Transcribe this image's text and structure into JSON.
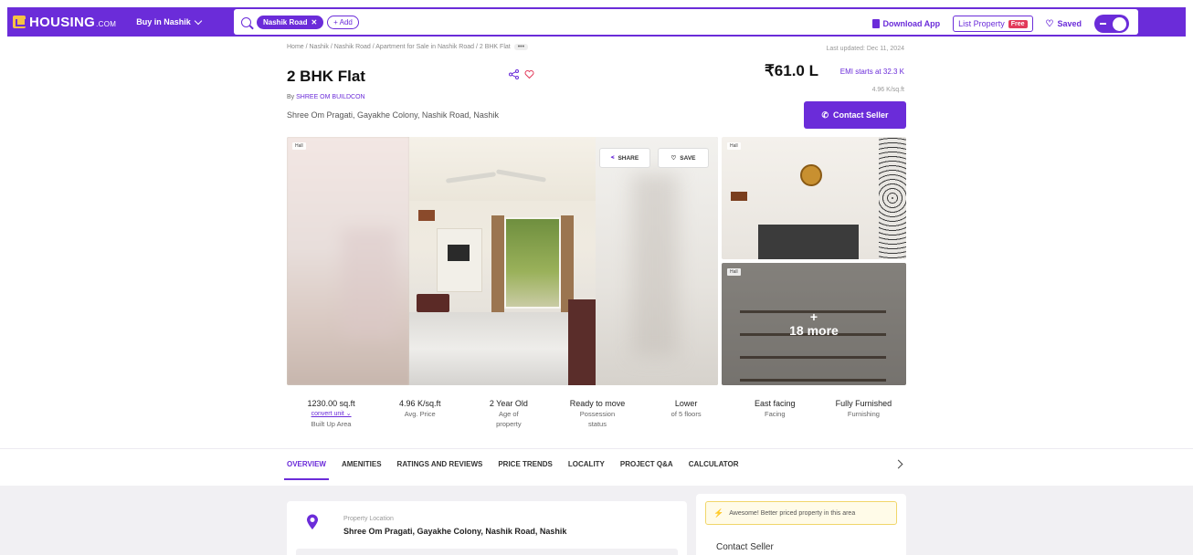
{
  "nav": {
    "logo_text": "HOUSING",
    "logo_suffix": ".COM",
    "buy_in": "Buy in Nashik",
    "search_chip": "Nashik Road",
    "add_label": "+ Add",
    "download_app": "Download App",
    "list_property": "List Property",
    "free_badge": "Free",
    "saved": "Saved"
  },
  "header": {
    "breadcrumb": "Home / Nashik / Nashik Road / Apartment for Sale in Nashik Road / 2 BHK Flat",
    "breadcrumb_more": "•••",
    "last_updated": "Last updated: Dec 11, 2024",
    "title": "2 BHK Flat",
    "by_prefix": "By ",
    "developer": "SHREE OM BUILDCON",
    "address": "Shree Om Pragati, Gayakhe Colony, Nashik Road, Nashik",
    "price": "₹61.0 L",
    "emi": "EMI starts at  32.3 K",
    "per_sqft": "4.96 K/sq.ft",
    "contact_button": "Contact Seller"
  },
  "gallery": {
    "tag_main": "Hall",
    "tag_side1": "Hall",
    "tag_side2": "Hall",
    "share_label": "SHARE",
    "save_label": "SAVE",
    "more_plus": "+",
    "more_label": "18 more"
  },
  "stats": [
    {
      "value": "1230.00 sq.ft",
      "link": "convert unit ⌄",
      "label": "Built Up Area"
    },
    {
      "value": "4.96 K/sq.ft",
      "label": "Avg. Price"
    },
    {
      "value": "2 Year Old",
      "label": "Age of property"
    },
    {
      "value": "Ready to move",
      "label": "Possession status"
    },
    {
      "value": "Lower",
      "label": "of 5 floors"
    },
    {
      "value": "East facing",
      "label": "Facing"
    },
    {
      "value": "Fully Furnished",
      "label": "Furnishing"
    }
  ],
  "tabs": [
    "OVERVIEW",
    "AMENITIES",
    "RATINGS AND REVIEWS",
    "PRICE TRENDS",
    "LOCALITY",
    "PROJECT Q&A",
    "CALCULATOR"
  ],
  "location_card": {
    "label": "Property Location",
    "value": "Shree Om Pragati, Gayakhe Colony, Nashik Road, Nashik"
  },
  "right_card": {
    "awesome": "Awesome! Better priced property in this area",
    "contact_seller": "Contact Seller"
  },
  "colors": {
    "brand": "#6b2cd9",
    "free_badge": "#e23a5a",
    "logo_mark": "#f6c244"
  },
  "icons": [
    "search-icon",
    "close-icon",
    "download-icon",
    "heart-icon",
    "share-icon",
    "phone-icon",
    "location-pin-icon",
    "chevron-right-icon",
    "bolt-icon",
    "avatar-icon"
  ]
}
